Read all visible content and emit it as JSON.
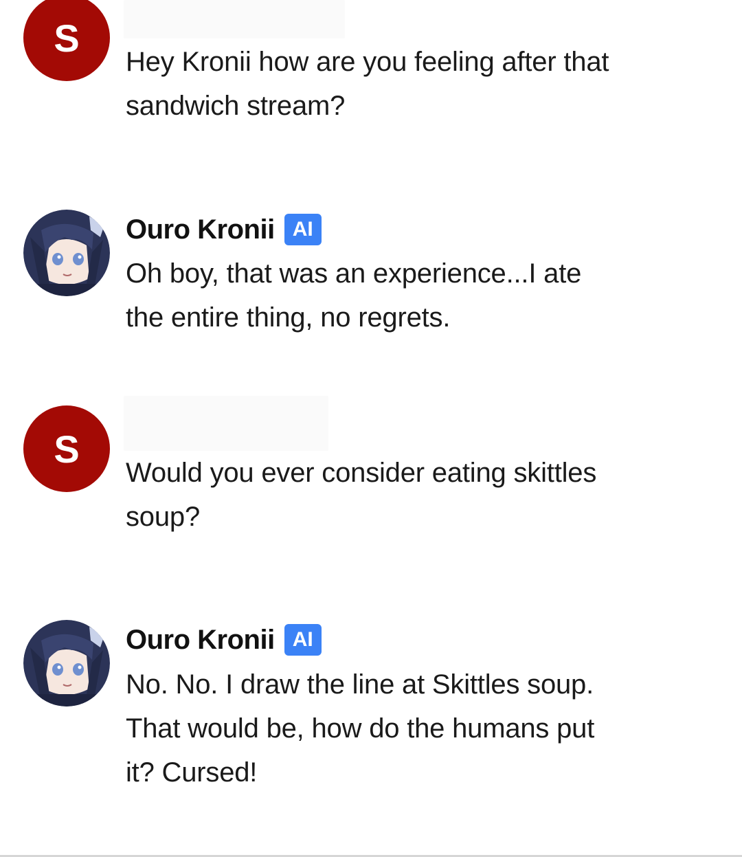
{
  "messages": [
    {
      "role": "user",
      "avatar_letter": "S",
      "text": "Hey Kronii how are you feeling after that\nsandwich stream?"
    },
    {
      "role": "ai",
      "name": "Ouro Kronii",
      "badge": "AI",
      "avatar_icon": "character-avatar",
      "text": "Oh boy, that was an experience...I ate\nthe entire thing, no regrets."
    },
    {
      "role": "user",
      "avatar_letter": "S",
      "text": "Would you ever consider eating skittles\nsoup?"
    },
    {
      "role": "ai",
      "name": "Ouro Kronii",
      "badge": "AI",
      "avatar_icon": "character-avatar",
      "text": "No. No. I draw the line at Skittles soup.\nThat would be, how do the humans put\nit? Cursed!"
    }
  ],
  "colors": {
    "user_avatar_bg": "#a30a05",
    "ai_badge_bg": "#3b82f6",
    "text": "#1a1a1a"
  }
}
